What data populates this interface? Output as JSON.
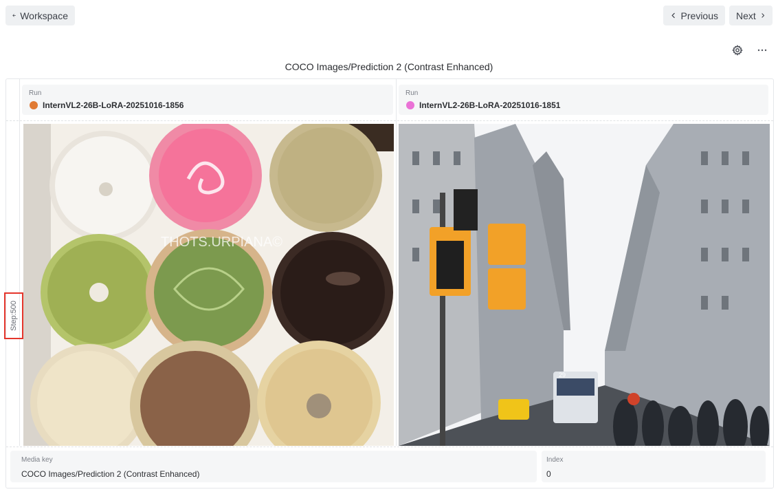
{
  "toolbar": {
    "workspace_label": "Workspace",
    "previous_label": "Previous",
    "next_label": "Next"
  },
  "panel": {
    "title": "COCO Images/Prediction 2 (Contrast Enhanced)",
    "step_label": "Step:500"
  },
  "runs": [
    {
      "label": "Run",
      "name": "InternVL2-26B-LoRA-20251016-1856",
      "color": "#e07a34"
    },
    {
      "label": "Run",
      "name": "InternVL2-26B-LoRA-20251016-1851",
      "color": "#ea72d6"
    }
  ],
  "images": [
    {
      "name": "donuts-image",
      "watermark": "THOTS.URPIANA©"
    },
    {
      "name": "city-street-image",
      "bus_number": "29"
    }
  ],
  "footer": {
    "media_key_label": "Media key",
    "media_key_value": "COCO Images/Prediction 2 (Contrast Enhanced)",
    "index_label": "Index",
    "index_value": "0"
  },
  "icons": {
    "back": "arrow-left-icon",
    "prev": "chevron-left-icon",
    "next": "chevron-right-icon",
    "settings": "gear-icon",
    "more": "more-horizontal-icon"
  }
}
